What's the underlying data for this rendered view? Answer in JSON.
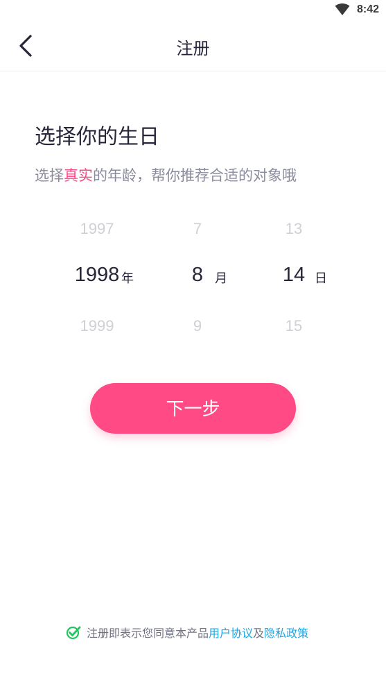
{
  "status_bar": {
    "time": "8:42",
    "wifi_icon": "wifi-icon"
  },
  "app_bar": {
    "back_icon": "chevron-left-icon",
    "title": "注册"
  },
  "content": {
    "heading": "选择你的生日",
    "subheading": {
      "prefix": "选择",
      "highlight": "真实",
      "suffix": "的年龄，帮你推荐合适的对象哦"
    },
    "accent_color": "#ff4a86"
  },
  "date_picker": {
    "year": {
      "prev": "1997",
      "selected": "1998",
      "next": "1999",
      "unit": "年"
    },
    "month": {
      "prev": "7",
      "selected": "8",
      "next": "9",
      "unit": "月"
    },
    "day": {
      "prev": "13",
      "selected": "14",
      "next": "15",
      "unit": "日"
    }
  },
  "next_button": {
    "label": "下一步",
    "color": "#ff4a86"
  },
  "agreement": {
    "check_icon": "check-circle-icon",
    "text": "注册即表示您同意本产品",
    "user_agreement_link": "用户协议",
    "and": "及",
    "privacy_link": "隐私政策",
    "link_color": "#1ca7e6",
    "check_color": "#23c55e"
  }
}
